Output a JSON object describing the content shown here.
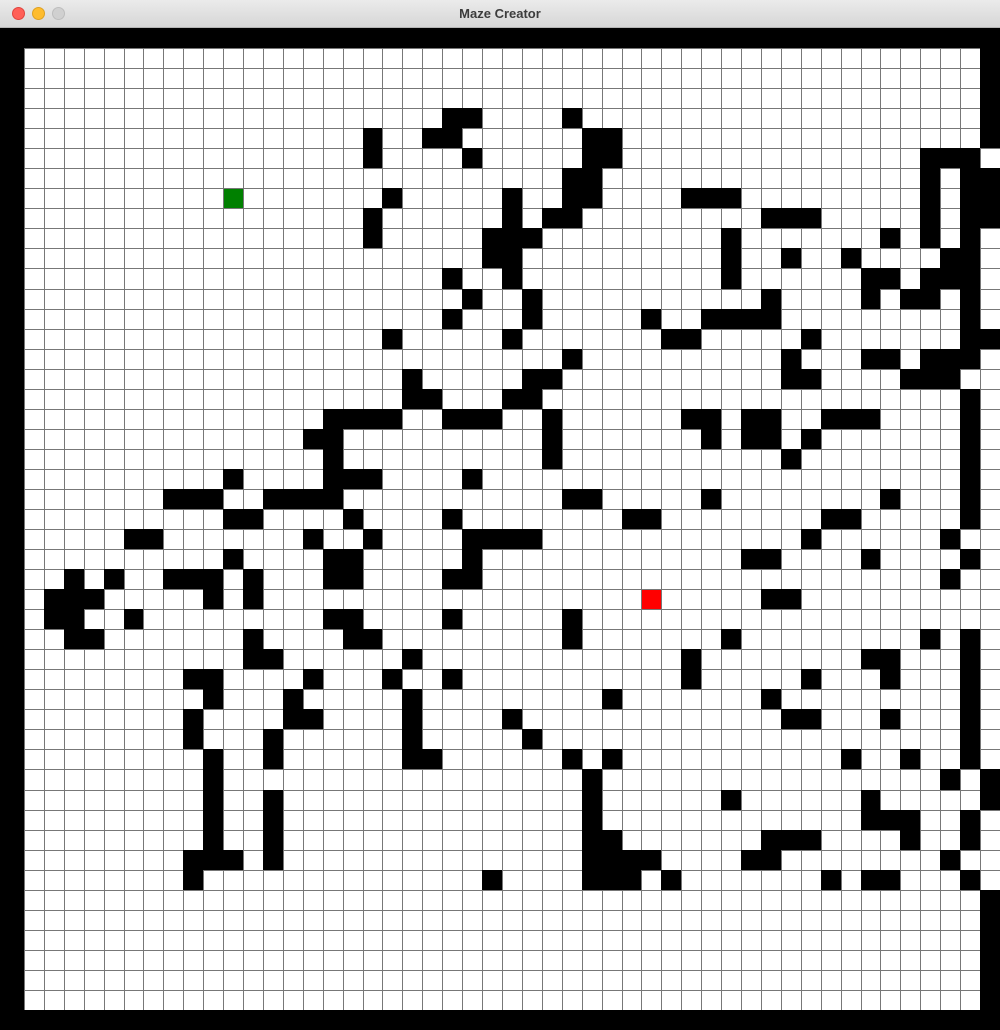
{
  "window": {
    "title": "Maze Creator"
  },
  "colors": {
    "wall": "#000000",
    "empty": "#ffffff",
    "grid_line": "#777777",
    "start": "#008000",
    "end": "#ff0000"
  },
  "maze": {
    "columns": 50,
    "rows": 50,
    "start": [
      11,
      8
    ],
    "end": [
      32,
      28
    ],
    "walls": [
      "##################################################",
      "#................................................#",
      "#................................................#",
      "#................................................#",
      "#.....................##....#....................#",
      "#.................#..##......##..................#",
      "#.................#....#.....##...............###",
      "#...........................##................#.##",
      "#..................#.....#..##....###.........#.##",
      "#.................#......#.##.........###.....#.##",
      "#.................#.....###.........#.......#.#.#.",
      "#.......................##..........#..#..#....##",
      "#.....................#..#..........#......##.###",
      "#......................#..#...........#....#.##.#",
      "#.....................#...#.....#..####.........#",
      "#..................#.....#.......##.....#.......##",
      "#...........................#..........#...##.###",
      "#...................#.....##...........##....###.",
      "#...................##...##.....................#",
      "#...............####..###..#......##.##..###....#",
      "#..............##..........#.......#.##.#.......#",
      "#...............#..........#...........#........#",
      "#..........#....###....#........................#",
      "#.......###..####...........##.....#........#...#",
      "#..........##....#....#........##........##.....#",
      "#.....##.......#..#....####.............#......#.",
      "#..........#....##.....#.............##....#....#",
      "#..#.#..###.#...##....##.......................#.",
      "#.###.....#.#...................#.....##.........",
      "#.##..#.........##....#.....#.....................",
      "#..##.......#....##.........#.......#.........#.#",
      "#...........##......#.............#........##...#",
      "#........##....#...#..#...........#.....#...#...#",
      "#.........#...#.....#.........#.......#.........#",
      "#........#....##....#....#.............##...#...#",
      "#........#...#......#.....#.....................#",
      "#.........#..#......##......#.#...........#..#..#",
      "#.........#..................#.................#.#",
      "#.........#..#...............#......#......#.....#",
      "#.........#..#...............#.............###..#",
      "#.........#..#...............##.......###....#..#",
      "#........###.#...............####....##........#",
      "#........#..............#....###.#.......#.##...#",
      "#................................................#",
      "#................................................#",
      "#................................................#",
      "#................................................#",
      "#................................................#",
      "#................................................#",
      "##################################################"
    ]
  }
}
